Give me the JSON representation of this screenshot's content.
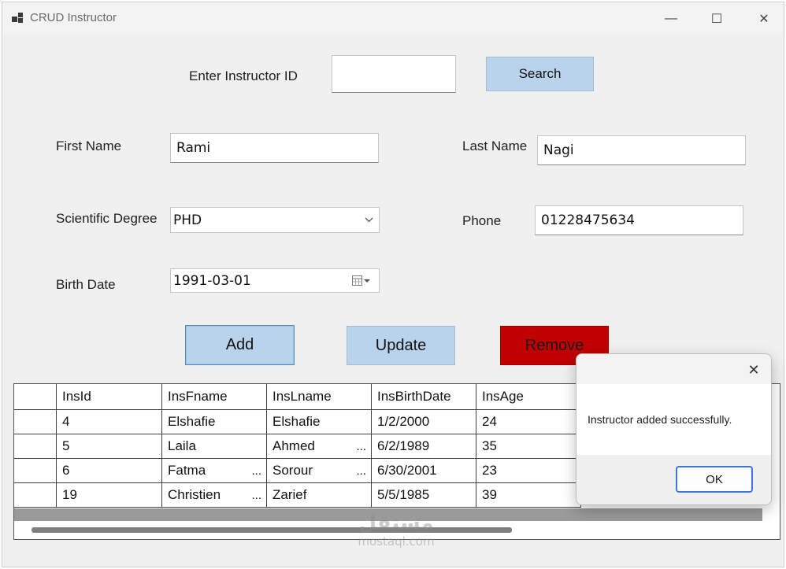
{
  "window": {
    "title": "CRUD Instructor",
    "minimize_glyph": "—",
    "maximize_glyph": "☐",
    "close_glyph": "✕"
  },
  "search": {
    "label": "Enter Instructor ID",
    "value": "",
    "button_label": "Search"
  },
  "form": {
    "first_name_label": "First Name",
    "first_name_value": "Rami",
    "last_name_label": "Last Name",
    "last_name_value": "Nagi",
    "degree_label": "Scientific Degree",
    "degree_value": "PHD",
    "phone_label": "Phone",
    "phone_value": "01228475634",
    "birth_label": "Birth Date",
    "birth_value": "1991-03-01"
  },
  "actions": {
    "add_label": "Add",
    "update_label": "Update",
    "remove_label": "Remove",
    "accent": "#b9d3ec",
    "danger": "#c00000"
  },
  "grid": {
    "columns": [
      "InsId",
      "InsFname",
      "InsLname",
      "InsBirthDate",
      "InsAge"
    ],
    "rows": [
      [
        "4",
        "Elshafie",
        "Elshafie",
        "1/2/2000",
        "24"
      ],
      [
        "5",
        "Laila",
        "Ahmed",
        "6/2/1989",
        "35"
      ],
      [
        "6",
        "Fatma",
        "Sorour",
        "6/30/2001",
        "23"
      ],
      [
        "19",
        "Christien",
        "Zarief",
        "5/5/1985",
        "39"
      ]
    ],
    "ellipsis": "..."
  },
  "dialog": {
    "message": "Instructor added successfully.",
    "ok_label": "OK",
    "close_glyph": "✕"
  },
  "watermark": {
    "arabic": "مستقل",
    "latin": "mostaql.com"
  }
}
